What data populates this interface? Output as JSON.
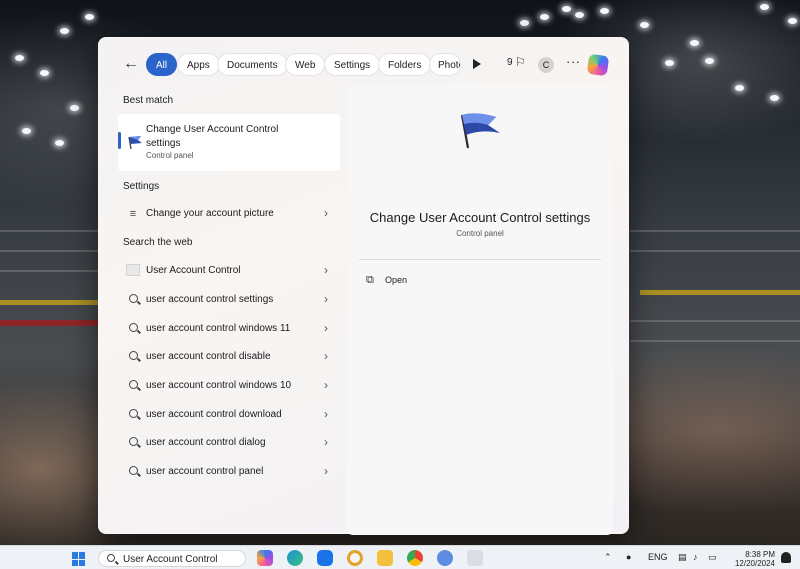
{
  "search_panel": {
    "filters": [
      {
        "label": "All",
        "active": true
      },
      {
        "label": "Apps",
        "active": false
      },
      {
        "label": "Documents",
        "active": false
      },
      {
        "label": "Web",
        "active": false
      },
      {
        "label": "Settings",
        "active": false
      },
      {
        "label": "Folders",
        "active": false
      },
      {
        "label": "Photo",
        "active": false
      }
    ],
    "rewards_points": "9",
    "account_initial": "C",
    "best_match": {
      "heading": "Best match",
      "title": "Change User Account Control settings",
      "subtitle": "Control panel",
      "icon": "flag-icon"
    },
    "settings": {
      "heading": "Settings",
      "items": [
        {
          "label": "Change your account picture",
          "icon": "account-picture-icon"
        }
      ]
    },
    "web": {
      "heading": "Search the web",
      "items": [
        {
          "label": "User Account Control",
          "icon": "web-thumbnail"
        },
        {
          "label": "user account control settings",
          "icon": "search-icon"
        },
        {
          "label": "user account control windows 11",
          "icon": "search-icon"
        },
        {
          "label": "user account control disable",
          "icon": "search-icon"
        },
        {
          "label": "user account control windows 10",
          "icon": "search-icon"
        },
        {
          "label": "user account control download",
          "icon": "search-icon"
        },
        {
          "label": "user account control dialog",
          "icon": "search-icon"
        },
        {
          "label": "user account control panel",
          "icon": "search-icon"
        }
      ]
    },
    "detail": {
      "title": "Change User Account Control settings",
      "subtitle": "Control panel",
      "actions": [
        {
          "label": "Open",
          "icon": "open-external-icon"
        }
      ]
    }
  },
  "taskbar": {
    "search_text": "User Account Control",
    "tray": {
      "language": "ENG",
      "time": "8:38 PM",
      "date": "12/20/2024"
    }
  },
  "colors": {
    "accent": "#2a63c9",
    "panel_bg": "#f4f2f3",
    "taskbar_bg": "#eef1f5"
  }
}
